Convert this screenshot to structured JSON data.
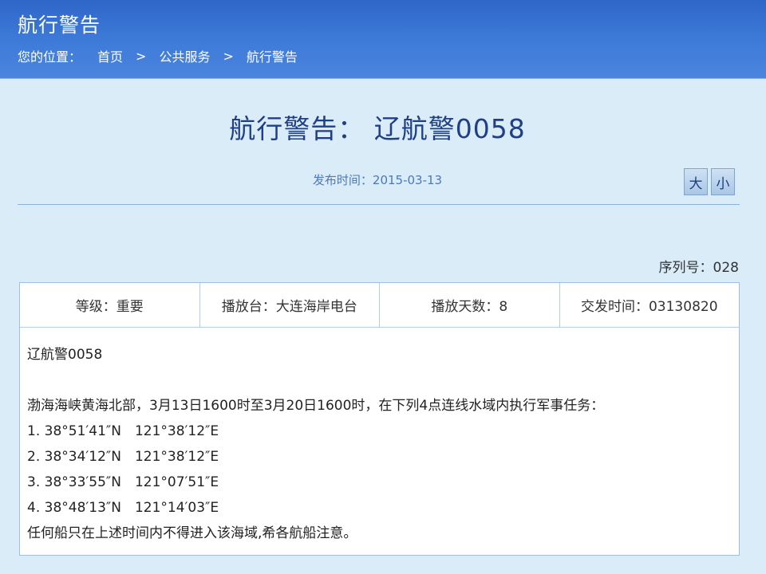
{
  "header": {
    "title": "航行警告",
    "breadcrumb": {
      "prefix": "您的位置：",
      "items": [
        "首页",
        "公共服务",
        "航行警告"
      ],
      "separator": ">"
    }
  },
  "article": {
    "title": "航行警告： 辽航警0058",
    "publish_time": "发布时间：2015-03-13",
    "font_size_buttons": [
      "大",
      "小"
    ],
    "serial": "序列号：028",
    "info": {
      "level": "等级：重要",
      "station": "播放台：大连海岸电台",
      "days": "播放天数：8",
      "dispatch_time": "交发时间：03130820"
    },
    "body": {
      "code": "辽航警0058",
      "intro": "渤海海峡黄海北部，3月13日1600时至3月20日1600时，在下列4点连线水域内执行军事任务：",
      "points": [
        "1. 38°51′41″N　121°38′12″E",
        "2. 38°34′12″N　121°38′12″E",
        "3. 38°33′55″N　121°07′51″E",
        "4. 38°48′13″N　121°14′03″E"
      ],
      "closing": "任何船只在上述时间内不得进入该海域,希各航船注意。"
    }
  }
}
